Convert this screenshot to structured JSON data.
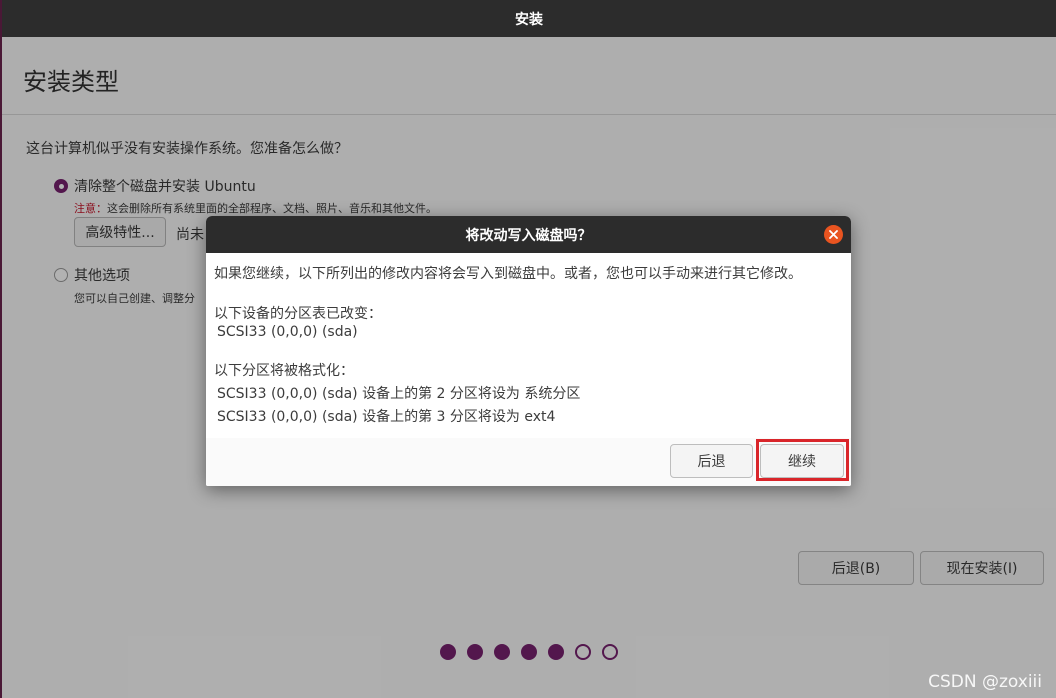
{
  "window": {
    "title": "安装"
  },
  "page": {
    "title": "安装类型",
    "question": "这台计算机似乎没有安装操作系统。您准备怎么做？",
    "options": [
      {
        "label": "清除整个磁盘并安装 Ubuntu",
        "selected": true
      },
      {
        "label": "其他选项",
        "selected": false
      }
    ],
    "note_label": "注意：",
    "note_text": "这会删除所有系统里面的全部程序、文档、照片、音乐和其他文件。",
    "advanced_button": "高级特性...",
    "advanced_status": "尚未",
    "other_desc": "您可以自己创建、调整分"
  },
  "nav": {
    "back_button": "后退(B)",
    "install_button": "现在安装(I)"
  },
  "progress": {
    "total_steps": 7,
    "completed_steps": 5
  },
  "dialog": {
    "title": "将改动写入磁盘吗？",
    "intro": "如果您继续，以下所列出的修改内容将会写入到磁盘中。或者，您也可以手动来进行其它修改。",
    "partition_table_heading": "以下设备的分区表已改变：",
    "partition_table_device": "SCSI33 (0,0,0) (sda)",
    "format_heading": "以下分区将被格式化：",
    "format_items": [
      "SCSI33 (0,0,0) (sda) 设备上的第 2 分区将设为 系统分区",
      "SCSI33 (0,0,0) (sda) 设备上的第 3 分区将设为 ext4"
    ],
    "back_button": "后退",
    "continue_button": "继续"
  },
  "watermark": "CSDN @zoxiii",
  "colors": {
    "accent": "#77216f",
    "close": "#e95420",
    "highlight": "#d9252a",
    "titlebar": "#2c2c2c"
  }
}
